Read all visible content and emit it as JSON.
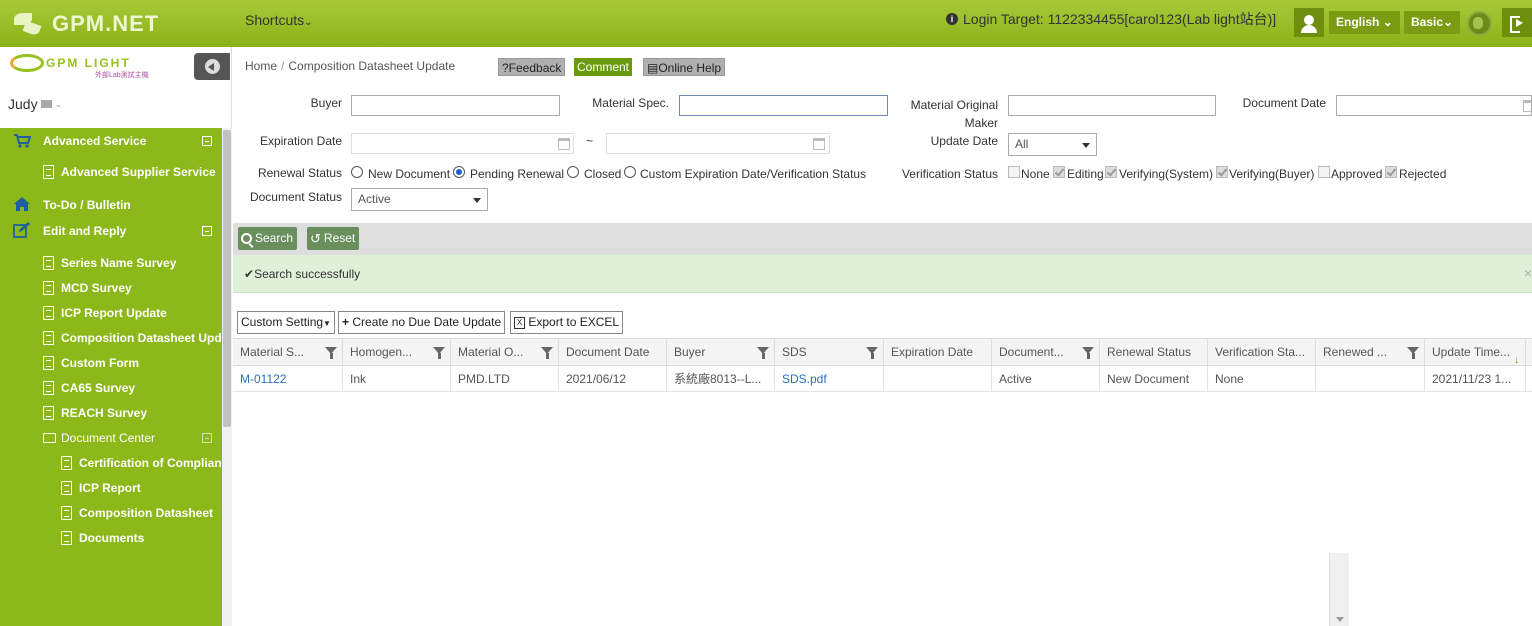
{
  "app": {
    "brand": "GPM.NET",
    "shortcuts_label": "Shortcuts",
    "login_target": "Login Target: 1122334455[carol123(Lab light站台)]",
    "language": "English",
    "mode": "Basic"
  },
  "sidebar": {
    "logo_text": "GPM LIGHT",
    "logo_sub": "外部Lab測試主機",
    "user": "Judy",
    "items": [
      {
        "label": "Advanced Service",
        "icon": "cart-icon"
      },
      {
        "label": "Advanced Supplier Service",
        "icon": "document-icon"
      },
      {
        "label": "To-Do / Bulletin",
        "icon": "home-icon"
      },
      {
        "label": "Edit and Reply",
        "icon": "edit-icon"
      },
      {
        "label": "Series Name Survey",
        "icon": "document-icon"
      },
      {
        "label": "MCD Survey",
        "icon": "document-icon"
      },
      {
        "label": "ICP Report Update",
        "icon": "document-icon"
      },
      {
        "label": "Composition Datasheet Update",
        "icon": "document-icon"
      },
      {
        "label": "Custom Form",
        "icon": "document-icon"
      },
      {
        "label": "CA65 Survey",
        "icon": "document-icon"
      },
      {
        "label": "REACH Survey",
        "icon": "document-icon"
      },
      {
        "label": "Document Center",
        "icon": "folder-icon"
      },
      {
        "label": "Certification of Compliance",
        "icon": "document-icon"
      },
      {
        "label": "ICP Report",
        "icon": "document-icon"
      },
      {
        "label": "Composition Datasheet",
        "icon": "document-icon"
      },
      {
        "label": "Documents",
        "icon": "document-icon"
      }
    ]
  },
  "breadcrumb": {
    "home": "Home",
    "sep": "/",
    "current": "Composition Datasheet Update"
  },
  "header_buttons": {
    "feedback": "?Feedback",
    "comment": "Comment",
    "online_help": "Online Help"
  },
  "filters": {
    "buyer_label": "Buyer",
    "buyer_value": "",
    "material_spec_label": "Material Spec.",
    "material_spec_value": "",
    "material_maker_label": "Material Original Maker",
    "material_maker_value": "",
    "document_date_label": "Document Date",
    "document_date_value": "",
    "expiration_date_label": "Expiration Date",
    "range_sep": "~",
    "update_date_label": "Update Date",
    "update_date_value": "All",
    "renewal_status_label": "Renewal Status",
    "renewal_options": [
      {
        "label": "New Document",
        "checked": false
      },
      {
        "label": "Pending Renewal",
        "checked": true
      },
      {
        "label": "Closed",
        "checked": false
      },
      {
        "label": "Custom Expiration Date/Verification Status",
        "checked": false
      }
    ],
    "verification_status_label": "Verification Status",
    "verification_options": [
      {
        "label": "None",
        "checked": false
      },
      {
        "label": "Editing",
        "checked": true
      },
      {
        "label": "Verifying(System)",
        "checked": true
      },
      {
        "label": "Verifying(Buyer)",
        "checked": true
      },
      {
        "label": "Approved",
        "checked": false
      },
      {
        "label": "Rejected",
        "checked": true
      }
    ],
    "document_status_label": "Document Status",
    "document_status_value": "Active"
  },
  "actions": {
    "search": "Search",
    "reset": "Reset"
  },
  "alert": {
    "message": "Search successfully",
    "close": "×"
  },
  "toolbar": {
    "custom_setting": "Custom Setting",
    "create_no_due": "Create no Due Date Update",
    "export_excel": "Export to EXCEL"
  },
  "table": {
    "columns": [
      "Material S...",
      "Homogen...",
      "Material O...",
      "Document Date",
      "Buyer",
      "SDS",
      "Expiration Date",
      "Document...",
      "Renewal Status",
      "Verification Sta...",
      "Renewed ...",
      "Update Time..."
    ],
    "rows": [
      [
        "M-01122",
        "Ink",
        "PMD.LTD",
        "2021/06/12",
        "系統廠8013--L...",
        "SDS.pdf",
        "",
        "Active",
        "New Document",
        "None",
        "",
        "2021/11/23 1..."
      ]
    ]
  }
}
